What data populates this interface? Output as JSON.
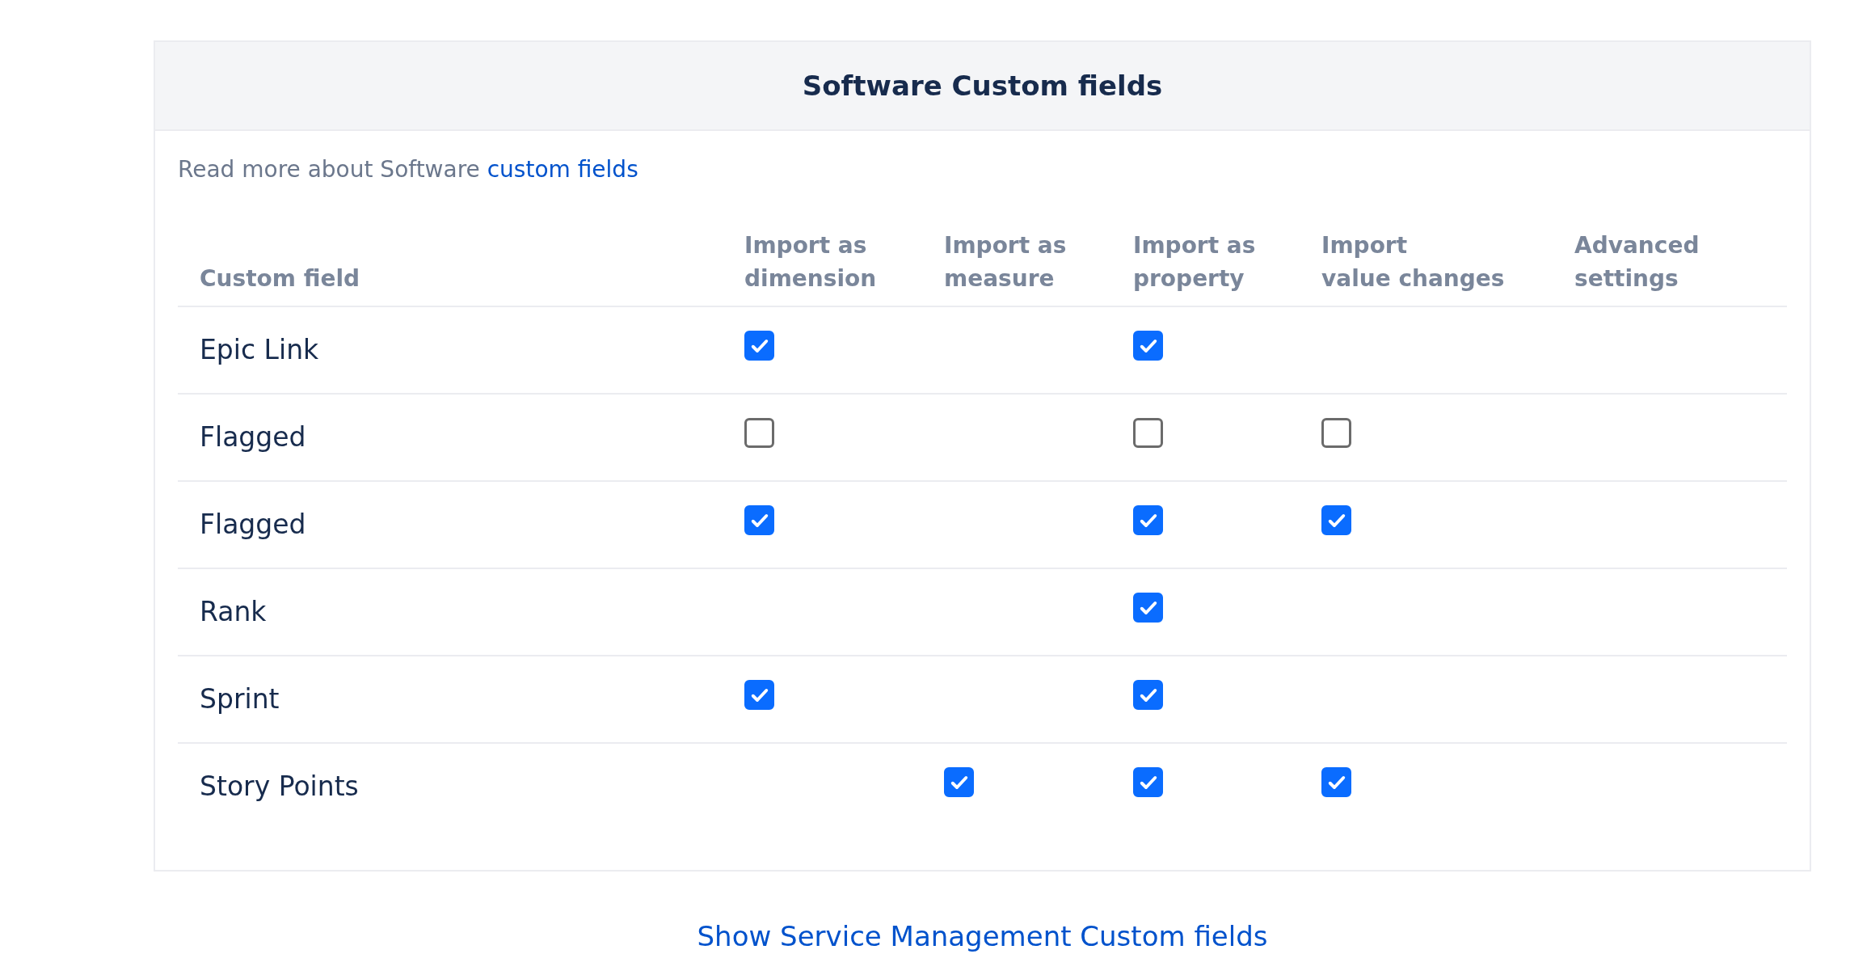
{
  "card": {
    "title": "Software Custom fields",
    "intro": "Read more about Software",
    "intro_link": "custom fields"
  },
  "table": {
    "columns": [
      "Custom field",
      "Import as\ndimension",
      "Import as\nmeasure",
      "Import as\nproperty",
      "Import\nvalue changes",
      "Advanced\nsettings"
    ],
    "rows": [
      {
        "name": "Epic Link",
        "import_as_dimension": true,
        "import_as_property": true
      },
      {
        "name": "Flagged",
        "import_as_dimension": false,
        "import_as_property": false,
        "import_value_changes": false
      },
      {
        "name": "Flagged",
        "import_as_dimension": true,
        "import_as_property": true,
        "import_value_changes": true
      },
      {
        "name": "Rank",
        "import_as_property": true
      },
      {
        "name": "Sprint",
        "import_as_dimension": true,
        "import_as_property": true
      },
      {
        "name": "Story Points",
        "import_as_measure": true,
        "import_as_property": true,
        "import_value_changes": true
      }
    ]
  },
  "footer_link": "Show Service Management Custom fields"
}
